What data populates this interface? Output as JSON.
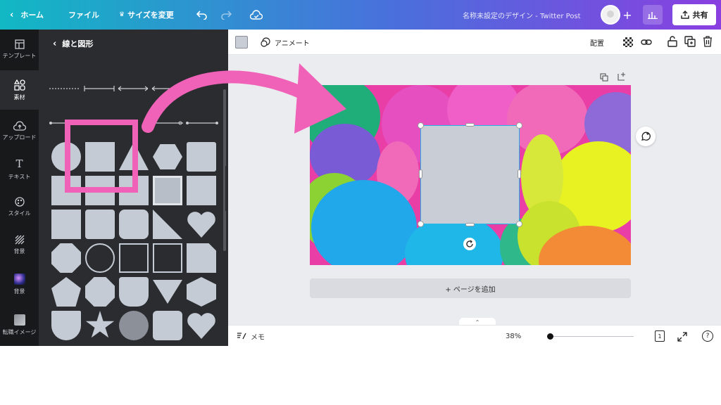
{
  "topbar": {
    "home_label": "ホーム",
    "file_label": "ファイル",
    "resize_label": "サイズを変更",
    "design_title": "名称未設定のデザイン - Twitter Post",
    "share_label": "共有"
  },
  "rail": {
    "items": [
      {
        "label": "テンプレート",
        "icon": "template-icon"
      },
      {
        "label": "素材",
        "icon": "elements-icon"
      },
      {
        "label": "アップロード",
        "icon": "upload-icon"
      },
      {
        "label": "テキスト",
        "icon": "text-icon"
      },
      {
        "label": "スタイル",
        "icon": "style-icon"
      },
      {
        "label": "背景",
        "icon": "background-icon"
      },
      {
        "label": "背景",
        "icon": "background-photo-icon"
      },
      {
        "label": "転職イメージ",
        "icon": "folder-icon"
      }
    ],
    "active_index": 1
  },
  "panel": {
    "title": "線と図形",
    "highlight_color": "#f062b7"
  },
  "editor": {
    "color_swatch": "#c9ced6",
    "animate_label": "アニメート",
    "arrange_label": "配置",
    "add_page_label": "+ ページを追加"
  },
  "footer": {
    "notes_label": "メモ",
    "zoom_label": "38%",
    "page_count": "1",
    "help_label": "?"
  },
  "colors": {
    "accent_pink": "#f062b7",
    "selection": "#22b7e8",
    "gradient_start": "#11b8c4",
    "gradient_end": "#8a3fe0"
  }
}
